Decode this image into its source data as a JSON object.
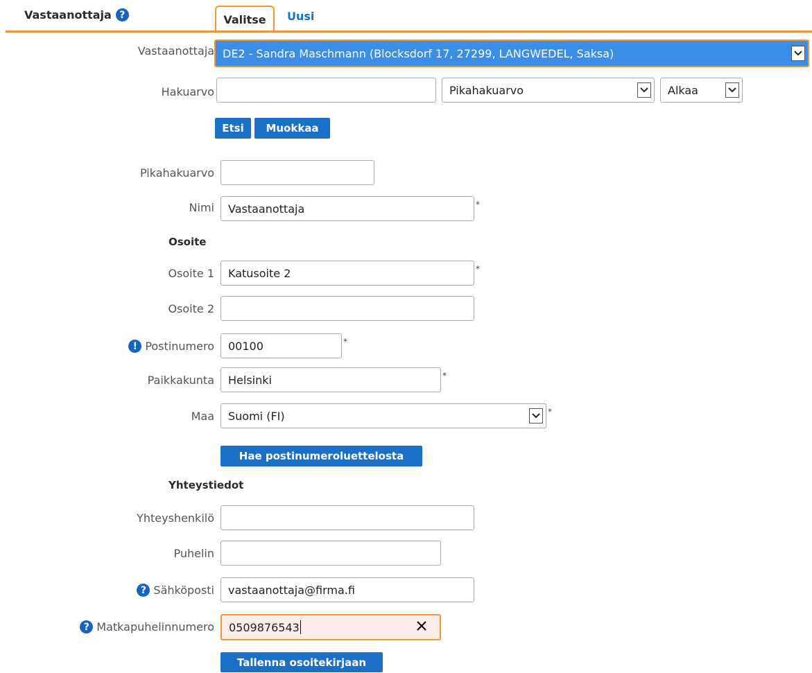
{
  "header": {
    "title": "Vastaanottaja",
    "tabs": [
      {
        "label": "Valitse",
        "active": true
      },
      {
        "label": "Uusi",
        "active": false
      }
    ]
  },
  "selector": {
    "recipient_label": "Vastaanottaja",
    "recipient_value": "DE2 - Sandra Maschmann (Blocksdorf 17, 27299, LANGWEDEL, Saksa)",
    "search_label": "Hakuarvo",
    "search_value": "",
    "search_type_value": "Pikahakuarvo",
    "search_mode_value": "Alkaa",
    "search_button": "Etsi",
    "edit_button": "Muokkaa"
  },
  "form": {
    "quick_search": {
      "label": "Pikahakuarvo",
      "value": ""
    },
    "name": {
      "label": "Nimi",
      "value": "Vastaanottaja",
      "required": "*"
    },
    "address_heading": "Osoite",
    "address1": {
      "label": "Osoite 1",
      "value": "Katusoite 2",
      "required": "*"
    },
    "address2": {
      "label": "Osoite 2",
      "value": ""
    },
    "postcode": {
      "label": "Postinumero",
      "value": "00100",
      "required": "*"
    },
    "city": {
      "label": "Paikkakunta",
      "value": "Helsinki",
      "required": "*"
    },
    "country": {
      "label": "Maa",
      "value": "Suomi (FI)",
      "required": "*"
    },
    "postcode_lookup_button": "Hae postinumeroluettelosta",
    "contact_heading": "Yhteystiedot",
    "contact_person": {
      "label": "Yhteyshenkilö",
      "value": ""
    },
    "phone": {
      "label": "Puhelin",
      "value": ""
    },
    "email": {
      "label": "Sähköposti",
      "value": "vastaanottaja@firma.fi"
    },
    "mobile": {
      "label": "Matkapuhelinnumero",
      "value": "0509876543"
    },
    "save_button": "Tallenna osoitekirjaan"
  },
  "icons": {
    "help": "question-circle-icon",
    "info": "exclamation-circle-icon",
    "clear": "close-icon",
    "dropdown": "chevron-down-icon"
  },
  "colors": {
    "accent": "#f0962e",
    "primary": "#1a6fc7",
    "selected_bg": "#3a8ee6",
    "active_input_bg": "#fcecea"
  }
}
